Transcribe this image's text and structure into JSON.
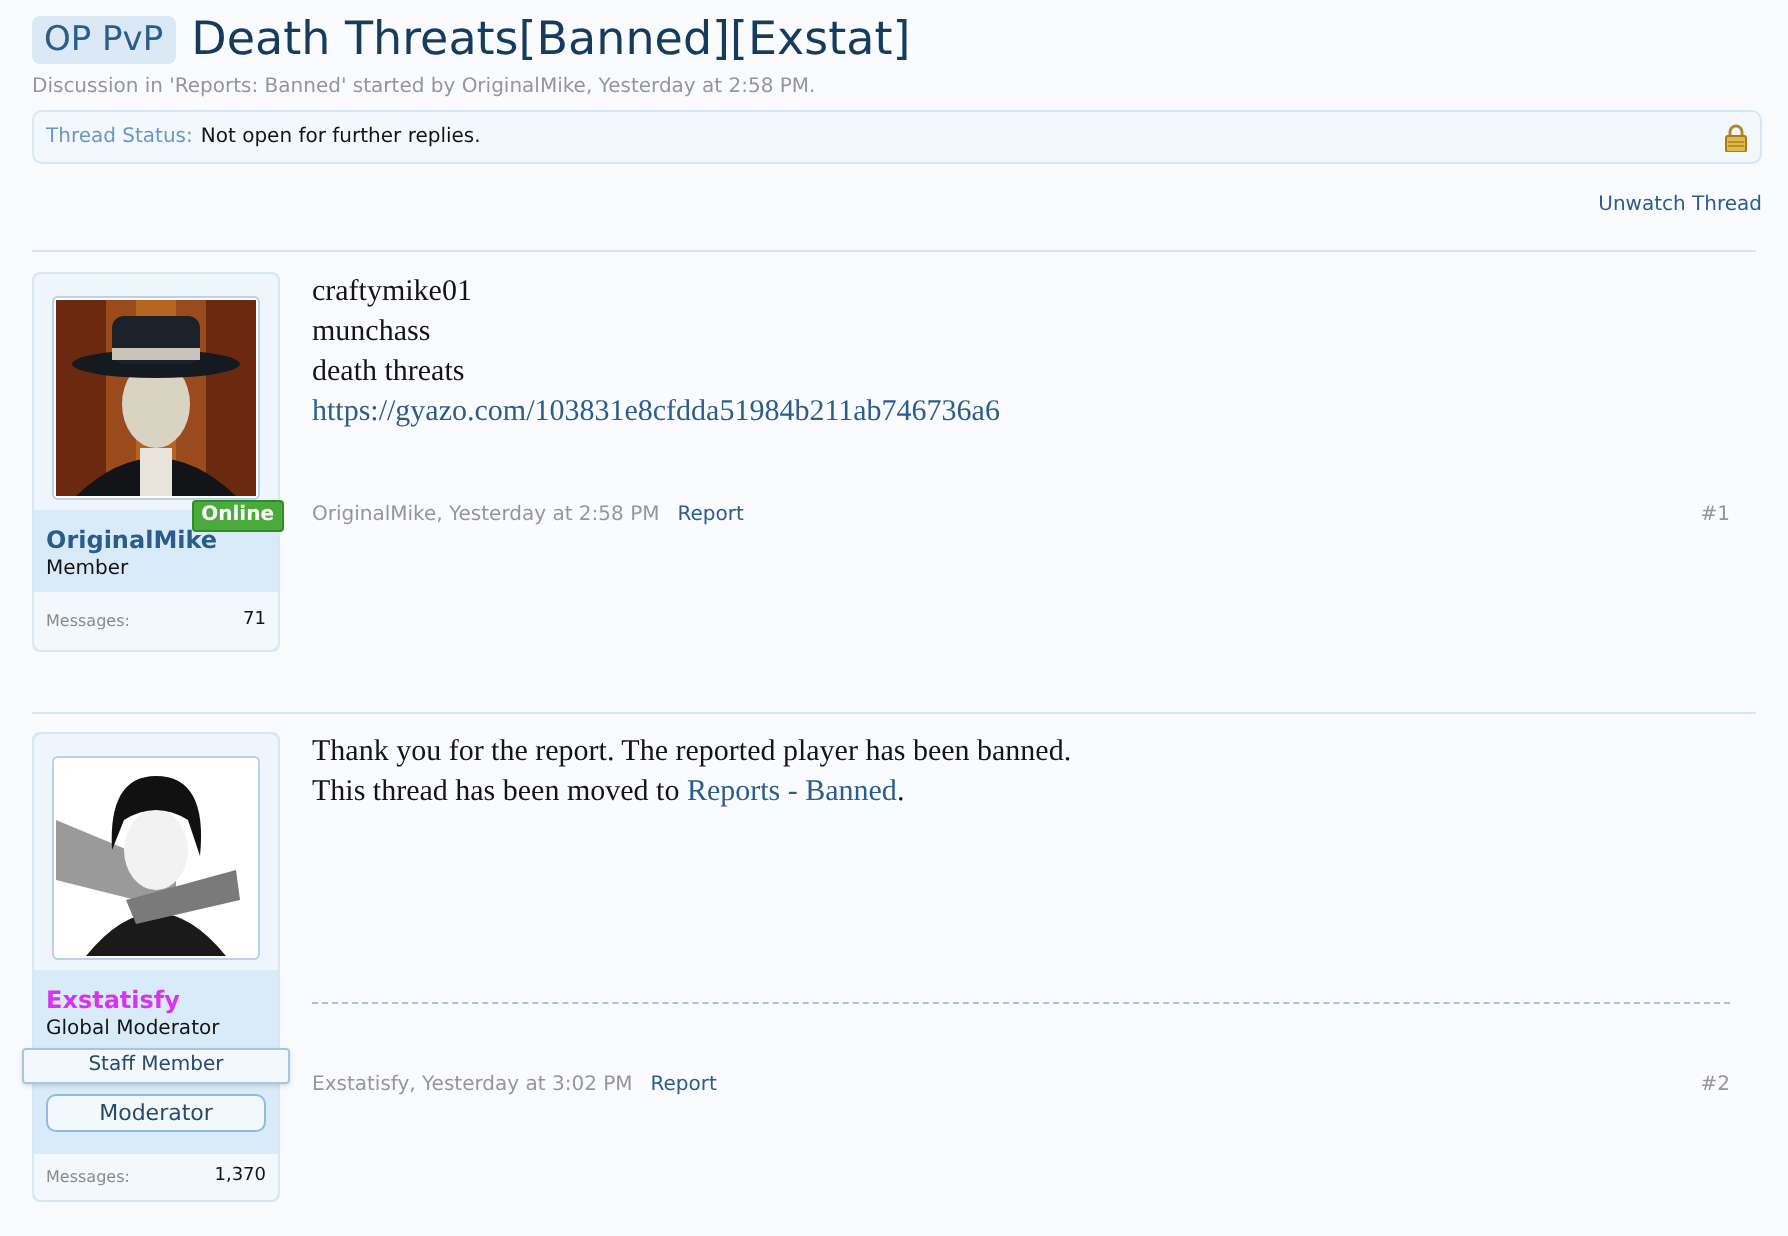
{
  "thread": {
    "prefix": "OP PvP",
    "title": "Death Threats[Banned][Exstat]",
    "meta": "Discussion in 'Reports: Banned' started by OriginalMike, Yesterday at 2:58 PM."
  },
  "status": {
    "label": "Thread Status:",
    "value": "Not open for further replies."
  },
  "unwatch_link": "Unwatch Thread",
  "posts": [
    {
      "user": {
        "name": "OriginalMike",
        "color": "#2b5d8c",
        "title": "Member",
        "online_badge": "Online",
        "messages_label": "Messages:",
        "messages": "71"
      },
      "body": [
        [
          {
            "text": "craftymike01",
            "kind": "text"
          }
        ],
        [
          {
            "text": "munchass",
            "kind": "text"
          }
        ],
        [
          {
            "text": "death threats",
            "kind": "text"
          }
        ],
        [
          {
            "text": "https://gyazo.com/103831e8cfdda51984b211ab746736a6",
            "kind": "link"
          }
        ]
      ],
      "signature": false,
      "author_time": "OriginalMike, Yesterday at 2:58 PM",
      "report": "Report",
      "number": "#1"
    },
    {
      "user": {
        "name": "Exstatisfy",
        "color": "#d633f2",
        "title": "Global Moderator",
        "staff_banner": "Staff Member",
        "user_banner": "Moderator",
        "messages_label": "Messages:",
        "messages": "1,370"
      },
      "body": [
        [
          {
            "text": "Thank you for the report. The reported player has been banned.",
            "kind": "text"
          }
        ],
        [
          {
            "text": "This thread has been moved to ",
            "kind": "text"
          },
          {
            "text": "Reports - Banned",
            "kind": "link"
          },
          {
            "text": ".",
            "kind": "text"
          }
        ]
      ],
      "signature": true,
      "author_time": "Exstatisfy, Yesterday at 3:02 PM",
      "report": "Report",
      "number": "#2"
    }
  ]
}
